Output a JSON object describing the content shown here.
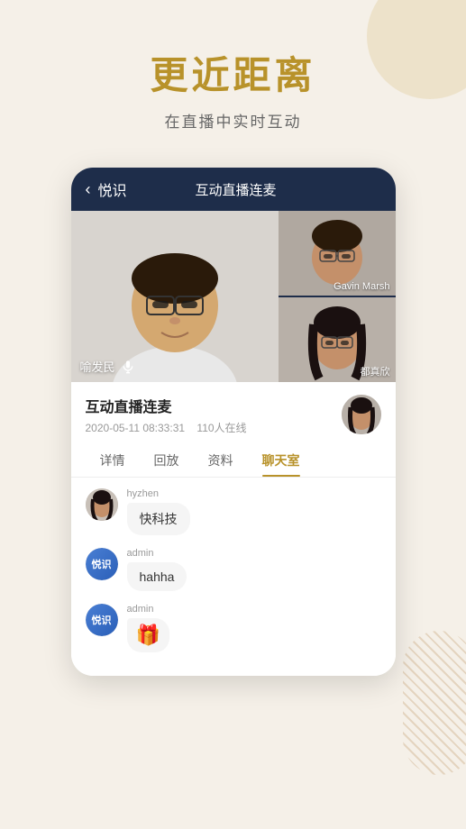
{
  "background": {
    "color": "#f5f0e8"
  },
  "header": {
    "main_title": "更近距离",
    "sub_title": "在直播中实时互动"
  },
  "app_bar": {
    "back_label": "悦识",
    "title": "互动直播连麦"
  },
  "video": {
    "main_speaker": "喻发民",
    "sidebar_top": "Gavin Marsh",
    "sidebar_bottom": "都真欣"
  },
  "live_info": {
    "title": "互动直播连麦",
    "date": "2020-05-11 08:33:31",
    "online": "110人在线"
  },
  "tabs": [
    {
      "label": "详情",
      "active": false
    },
    {
      "label": "回放",
      "active": false
    },
    {
      "label": "资料",
      "active": false
    },
    {
      "label": "聊天室",
      "active": true
    }
  ],
  "chat": {
    "messages": [
      {
        "avatar_type": "img",
        "username": "hyzhen",
        "text": "快科技",
        "emoji": false
      },
      {
        "avatar_type": "badge",
        "badge_text": "悦识",
        "username": "admin",
        "text": "hahha",
        "emoji": false
      },
      {
        "avatar_type": "badge",
        "badge_text": "悦识",
        "username": "admin",
        "text": "🎁",
        "emoji": true
      }
    ]
  }
}
